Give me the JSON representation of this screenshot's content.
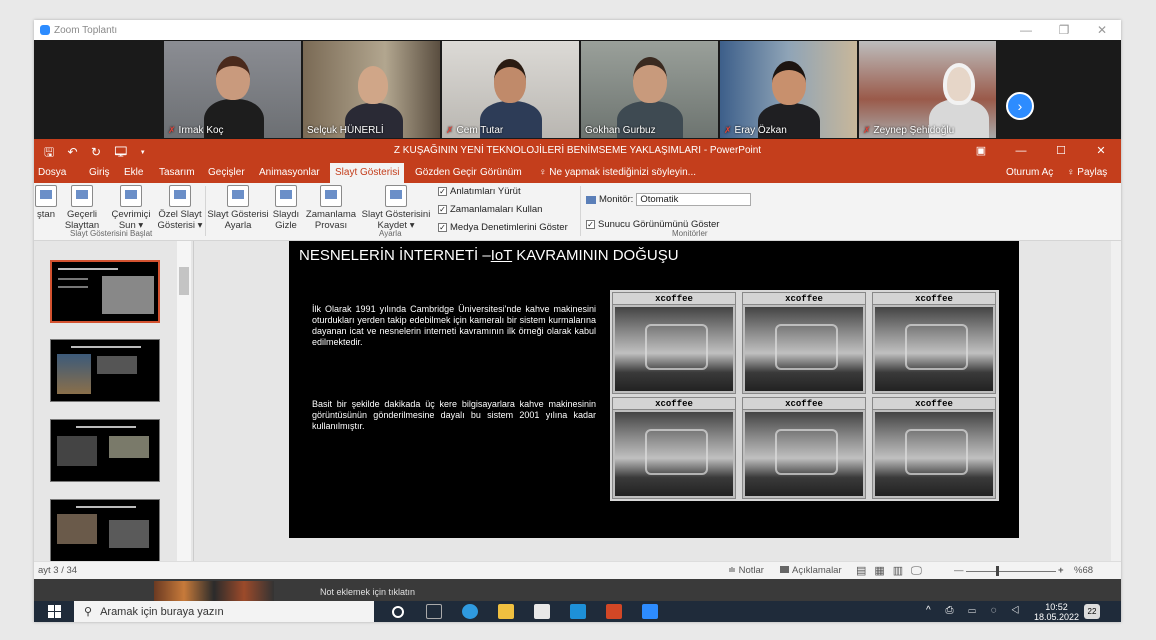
{
  "zoom": {
    "title": "Zoom Toplantı",
    "controls": [
      "—",
      "❐",
      "✕"
    ]
  },
  "participants": [
    {
      "name": "Irmak Koç",
      "muted": true
    },
    {
      "name": "Selçuk HÜNERLİ",
      "muted": false
    },
    {
      "name": "Cem Tutar",
      "muted": true
    },
    {
      "name": "Gokhan Gurbuz",
      "muted": false
    },
    {
      "name": "Eray Özkan",
      "muted": true
    },
    {
      "name": "Zeynep Şehidoğlu",
      "muted": true
    }
  ],
  "ppt": {
    "quick_access": "🖫 ↶ ↻ 🖵 ▾",
    "doc_title": "Z KUŞAĞININ YENİ TEKNOLOJİLERİ BENİMSEME YAKLAŞIMLARI - PowerPoint",
    "window_controls": [
      "▣",
      "—",
      "☐",
      "✕"
    ],
    "tabs": [
      "Dosya",
      "Giriş",
      "Ekle",
      "Tasarım",
      "Geçişler",
      "Animasyonlar",
      "Slayt Gösterisi",
      "Gözden Geçir",
      "Görünüm",
      "♀ Ne yapmak istediğinizi söyleyin..."
    ],
    "selected_tab": "Slayt Gösterisi",
    "account": "Oturum Aç",
    "share": "♀ Paylaş"
  },
  "ribbon": {
    "buttons": [
      {
        "l1": "ştan",
        "l2": ""
      },
      {
        "l1": "Geçerli",
        "l2": "Slayttan"
      },
      {
        "l1": "Çevrimiçi",
        "l2": "Sun ▾"
      },
      {
        "l1": "Özel Slayt",
        "l2": "Gösterisi ▾"
      },
      {
        "l1": "Slayt Gösterisi",
        "l2": "Ayarla"
      },
      {
        "l1": "Slaydı",
        "l2": "Gizle"
      },
      {
        "l1": "Zamanlama",
        "l2": "Provası"
      },
      {
        "l1": "Slayt Gösterisini",
        "l2": "Kaydet ▾"
      }
    ],
    "checkboxes": [
      "Anlatımları Yürüt",
      "Zamanlamaları Kullan",
      "Medya Denetimlerini Göster"
    ],
    "monitor_label": "Monitör:",
    "monitor_value": "Otomatik",
    "presenter_view": "Sunucu Görünümünü Göster",
    "groups": [
      "Slayt Gösterisini Başlat",
      "Ayarla",
      "Monitörler"
    ]
  },
  "slide": {
    "title_prefix": "NESNELERİN İNTERNETİ –",
    "title_iot": "IoT",
    "title_suffix": " KAVRAMININ DOĞUŞU",
    "para1": "İlk Olarak 1991 yılında Cambridge Üniversitesi'nde kahve makinesini oturdukları yerden takip edebilmek için kameralı bir sistem kurmalarına dayanan icat ve nesnelerin interneti kavramının ilk örneği olarak kabul edilmektedir.",
    "para2": "Basit bir şekilde dakikada üç kere bilgisayarlara kahve makinesinin görüntüsünün gönderilmesine dayalı bu sistem 2001 yılına kadar kullanılmıştır.",
    "cam_label": "xcoffee"
  },
  "status": {
    "slide_counter": "ayt 3 / 34",
    "notes": "≐ Notlar",
    "comments": "Açıklamalar",
    "zoom_minus": "—",
    "zoom_plus": "+",
    "zoom_level": "%68"
  },
  "notes_pane": {
    "hint": "Not eklemek için tıklatın"
  },
  "taskbar": {
    "search_placeholder": "Aramak için buraya yazın",
    "tray": "^ ⎙ ▭ ◌ ◁",
    "time": "10:52",
    "date": "18.05.2022",
    "notifications": "22"
  },
  "colors": {
    "ppt_accent": "#c43e1c",
    "zoom_blue": "#2d8cff"
  }
}
